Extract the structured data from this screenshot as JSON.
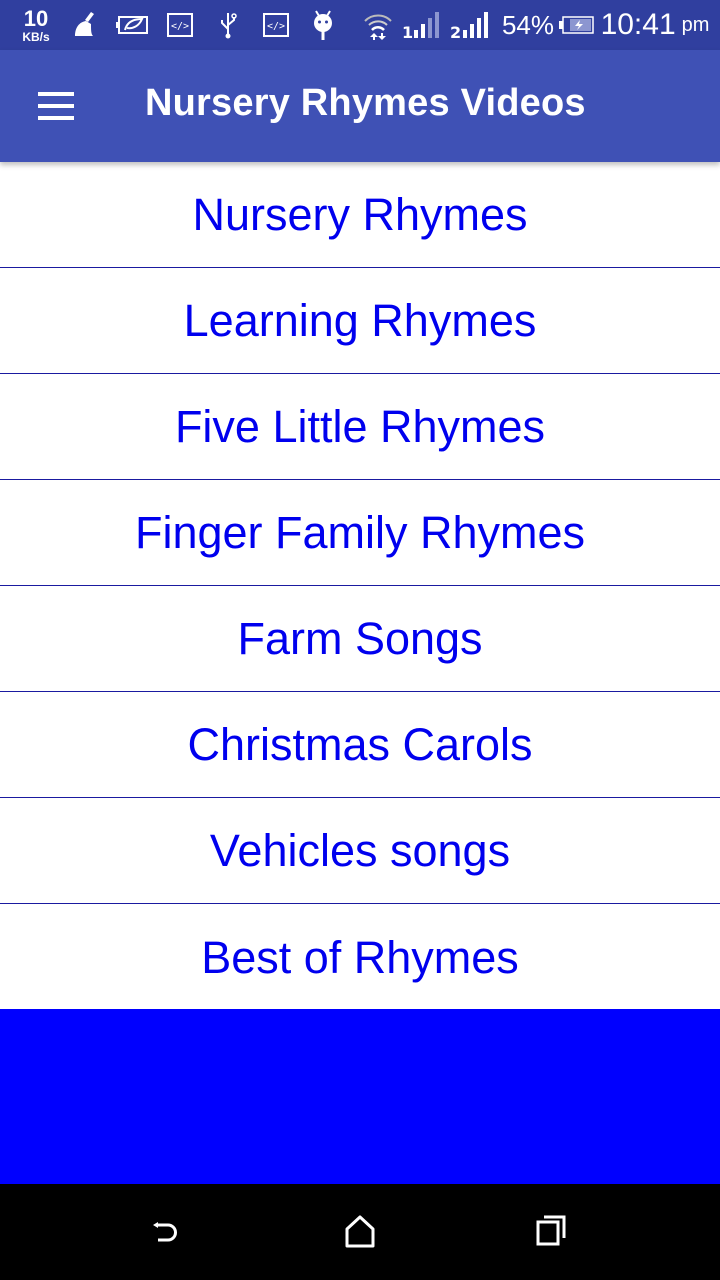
{
  "status_bar": {
    "net_speed_value": "10",
    "net_speed_unit": "KB/s",
    "icons": [
      "cleaner-broom-icon",
      "battery-saver-leaf-icon",
      "developer-code-icon",
      "usb-icon",
      "developer-code-icon",
      "android-debug-icon",
      "wifi-data-transfer-icon",
      "signal-sim1-icon",
      "signal-sim2-icon",
      "battery-charging-icon"
    ],
    "sim1_label": "1",
    "sim2_label": "2",
    "battery_percent": "54%",
    "time": "10:41",
    "time_suffix": "pm"
  },
  "app_bar": {
    "title": "Nursery Rhymes Videos",
    "menu_icon": "hamburger-menu-icon"
  },
  "categories": [
    {
      "label": "Nursery Rhymes"
    },
    {
      "label": "Learning Rhymes"
    },
    {
      "label": "Five Little Rhymes"
    },
    {
      "label": "Finger Family Rhymes"
    },
    {
      "label": "Farm Songs"
    },
    {
      "label": "Christmas Carols"
    },
    {
      "label": "Vehicles songs"
    },
    {
      "label": "Best of Rhymes"
    }
  ],
  "colors": {
    "status_bar": "#303f9f",
    "app_bar": "#3f51b5",
    "item_text": "#0000ee",
    "banner": "#0000ff",
    "nav_bar": "#000000"
  },
  "nav_bar": {
    "back": "back-icon",
    "home": "home-icon",
    "recents": "recents-icon"
  }
}
